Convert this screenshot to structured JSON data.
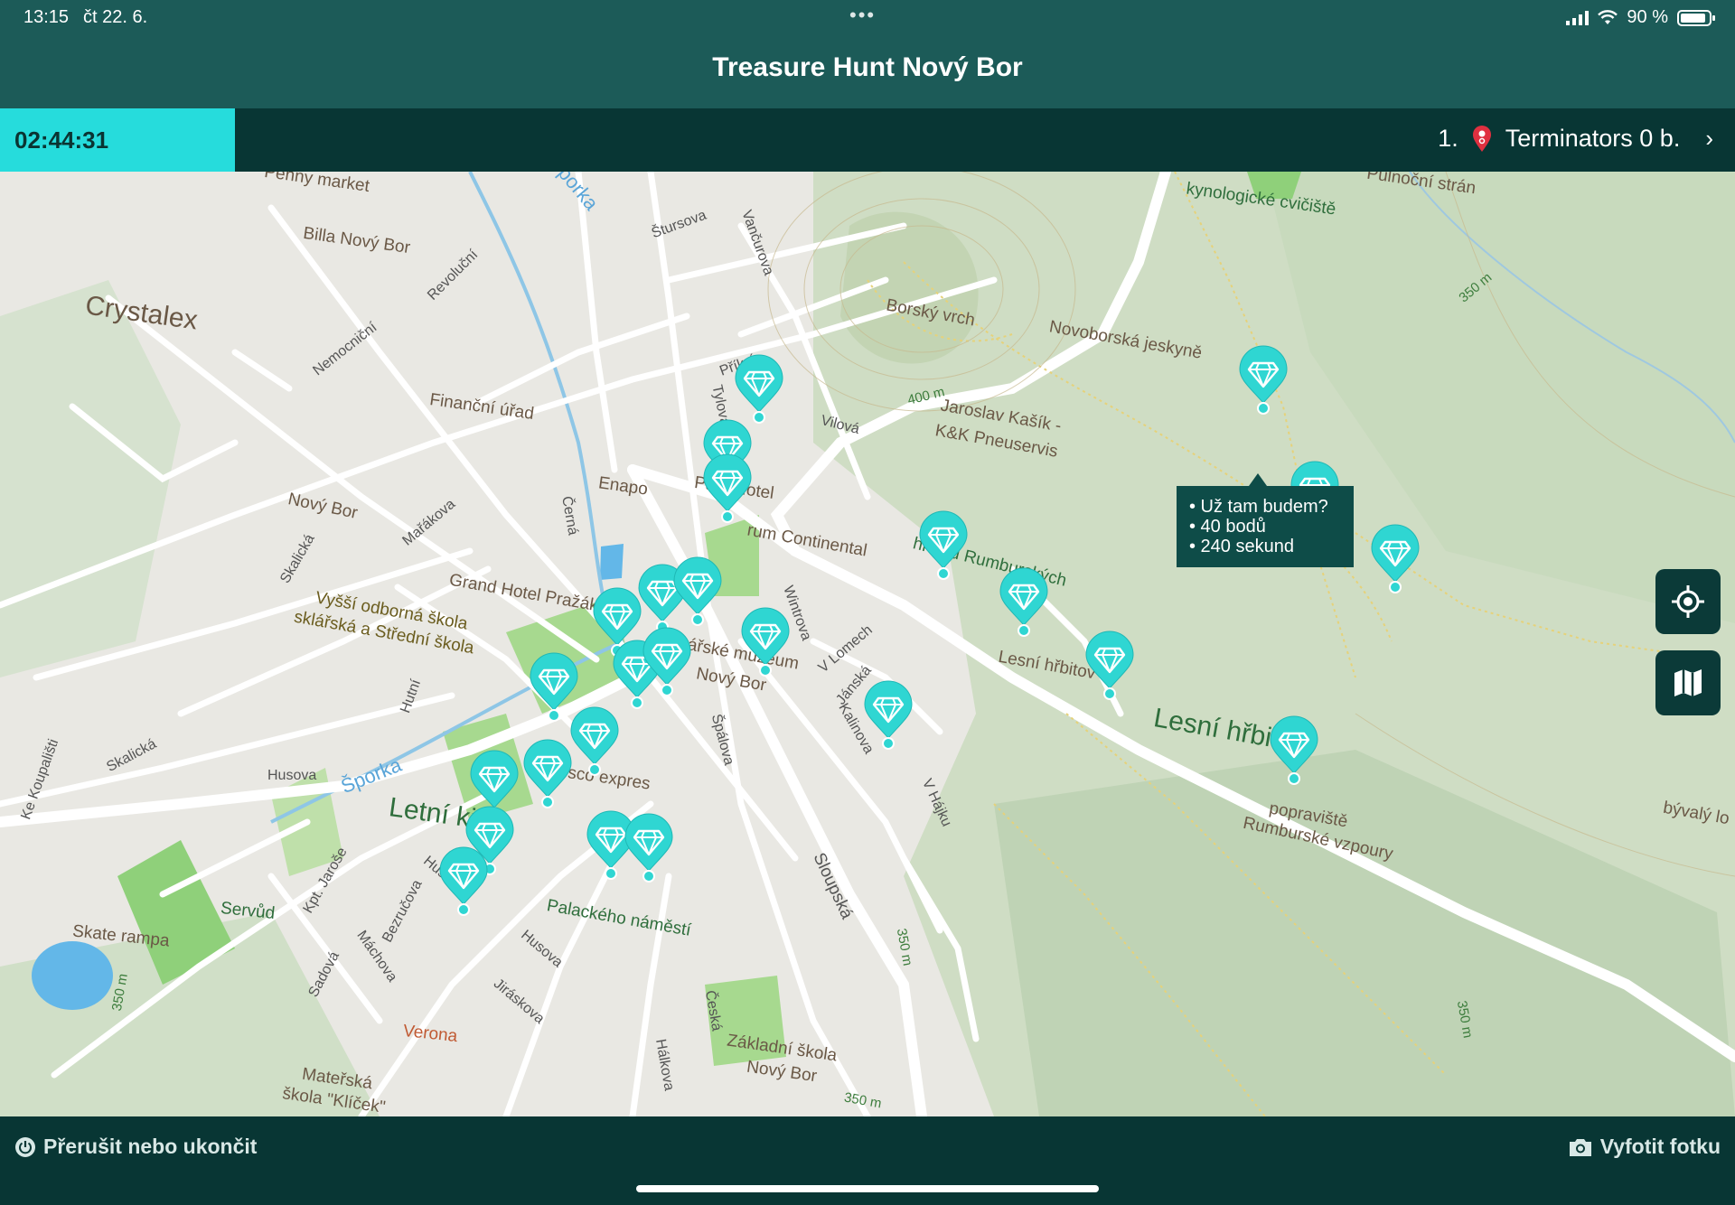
{
  "status_bar": {
    "time": "13:15",
    "date": "čt 22. 6.",
    "battery": "90 %"
  },
  "header": {
    "title": "Treasure Hunt Nový Bor"
  },
  "info_bar": {
    "timer": "02:44:31",
    "rank": "1.",
    "team": "Terminators 0 b."
  },
  "map": {
    "labels": {
      "penny": "Penny market",
      "billa": "Billa Nový Bor",
      "crystalex": "Crystalex",
      "revolucni": "Revoluční",
      "nemocnicni": "Nemocniční",
      "financni": "Finanční úřad",
      "enapo": "Enapo",
      "novy_bor": "Nový Bor",
      "marakova": "Mařákova",
      "skalicka": "Skalická",
      "grand_hotel": "Grand Hotel Pražák",
      "vyssi_skola": "Vyšší odborná škola",
      "sklarska_skola": "sklářská a Střední škola",
      "hutni": "Hutní",
      "husova": "Husova",
      "sporka": "Šporka",
      "letni_kino": "Letní kino",
      "skate": "Skate rampa",
      "servud": "Servůd",
      "verona": "Verona",
      "materska": "Mateřská",
      "skola_klicek": "škola \"Klíček\"",
      "palackeho": "Palackého náměstí",
      "tesco": "Tesco expres",
      "muzeum": "ářské muzeum",
      "muzeum_novy_bor": "Nový Bor",
      "park_hotel": "Park Hotel",
      "continental": "rum Continental",
      "sturova": "Štursova",
      "vancurova": "Vančurova",
      "prikra": "Příkrá",
      "tylova": "Tylova",
      "cerna": "Černá",
      "vilova": "Vilová",
      "wintrova": "Wintrova",
      "v_lomech": "V Lomech",
      "janska": "Jánská",
      "kalinova": "Kalinova",
      "spalova": "Špálova",
      "v_hajku": "V Hájku",
      "sloupska": "Sloupská",
      "ceska": "Česká",
      "halkova": "Hálkova",
      "jiraskova": "Jiráskova",
      "zakladni_skola": "Základní škola",
      "zs_novy_bor": "Nový Bor",
      "borsky_vrch": "Borský vrch",
      "novoborska": "Novoborská jeskyně",
      "jaroslav": "Jaroslav Kašík -",
      "pneuservis": "K&K Pneuservis",
      "kynologicke": "kynologické cvičiště",
      "pulnocni": "Půlnoční strán",
      "hrdinu": "hrdinů Rumburských",
      "lesni_hrbitov": "Lesní hřbitov",
      "lesni_hrbitov_big": "Lesní hřbit",
      "popraviste": "popraviště",
      "rumburske": "Rumburské vzpoury",
      "byvaly": "bývalý lo",
      "ke_koupalisti": "Ke Koupališti",
      "kpt_jarose": "Kpt. Jaroše",
      "bezrucova": "Bezručova",
      "machova": "Máchova",
      "sadova": "Sadová",
      "alt_350": "350 m",
      "alt_400": "400 m"
    },
    "tooltip": {
      "line1": "• Už tam budem?",
      "line2": "• 40 bodů",
      "line3": "• 240 sekund"
    }
  },
  "controls": {
    "locate_icon": "locate-icon",
    "map_icon": "map-layers-icon"
  },
  "bottom_bar": {
    "quit_label": "Přerušit nebo ukončit",
    "photo_label": "Vyfotit fotku"
  },
  "colors": {
    "header": "#1c5b58",
    "bar": "#083634",
    "accent": "#26dcdc",
    "marker": "#2fd6d2"
  }
}
